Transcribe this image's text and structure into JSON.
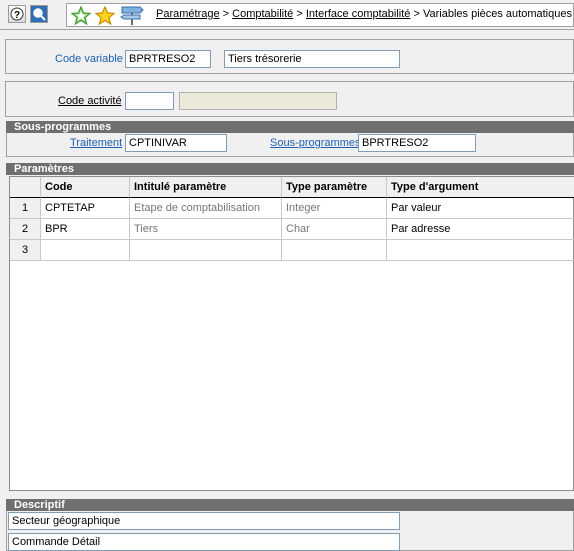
{
  "breadcrumb": {
    "item1": "Paramétrage",
    "sep": ">",
    "item2": "Comptabilité",
    "item3": "Interface comptabilité",
    "current": "Variables pièces automatiques"
  },
  "header": {
    "code_variable_label": "Code variable",
    "code_variable_value": "BPRTRESO2",
    "description_value": "Tiers trésorerie",
    "code_activite_label": "Code activité",
    "code_activite_value": "",
    "code_activite_desc": ""
  },
  "sous_programmes": {
    "title": "Sous-programmes",
    "traitement_label": "Traitement",
    "traitement_value": "CPTINIVAR",
    "sous_programmes_label": "Sous-programmes",
    "sous_programmes_value": "BPRTRESO2"
  },
  "parametres": {
    "title": "Paramètres",
    "columns": [
      "Code",
      "Intitulé paramètre",
      "Type paramètre",
      "Type d'argument"
    ],
    "rows": [
      {
        "num": "1",
        "code": "CPTETAP",
        "intitule": "Etape de comptabilisation",
        "type": "Integer",
        "argument": "Par valeur"
      },
      {
        "num": "2",
        "code": "BPR",
        "intitule": "Tiers",
        "type": "Char",
        "argument": "Par adresse"
      },
      {
        "num": "3",
        "code": "",
        "intitule": "",
        "type": "",
        "argument": ""
      }
    ]
  },
  "descriptif": {
    "title": "Descriptif",
    "line1": "Secteur géographique",
    "line2": "Commande Détail"
  },
  "icons": [
    "help-icon",
    "zoom-icon",
    "star-outline-icon",
    "star-icon",
    "signpost-icon"
  ]
}
